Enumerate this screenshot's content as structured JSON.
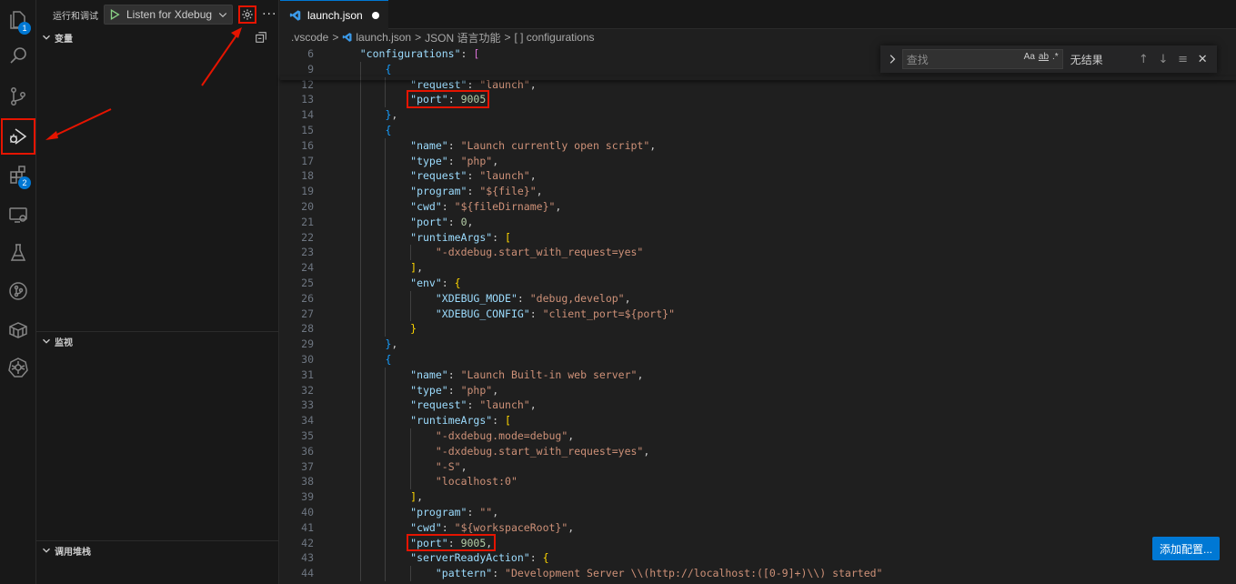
{
  "sidebar": {
    "title": "运行和调试",
    "run_config": "Listen for Xdebug",
    "more": "···",
    "sections": {
      "variables": "变量",
      "watch": "监视",
      "callstack": "调用堆栈"
    }
  },
  "activity": {
    "explorer_badge": "1",
    "extensions_badge": "2"
  },
  "tab": {
    "label": "launch.json"
  },
  "breadcrumb": {
    "folder": ".vscode",
    "file": "launch.json",
    "lang": "JSON 语言功能",
    "symbol": "[ ] configurations"
  },
  "find": {
    "placeholder": "查找",
    "opt_case": "Aa",
    "opt_word": "ab",
    "opt_regex": ".*",
    "status": "无结果",
    "prev": "↑",
    "next": "↓",
    "selection": "≡",
    "close": "✕"
  },
  "add_config": "添加配置...",
  "lines": [
    {
      "n": "6",
      "indent": 1,
      "t": [
        [
          "k",
          "\"configurations\""
        ],
        [
          "p",
          ": "
        ],
        [
          "b2",
          "["
        ]
      ]
    },
    {
      "n": "9",
      "indent": 2,
      "t": [
        [
          "b3",
          "{"
        ]
      ]
    },
    {
      "n": "12",
      "indent": 3,
      "t": [
        [
          "k",
          "\"request\""
        ],
        [
          "p",
          ": "
        ],
        [
          "s",
          "\"launch\""
        ],
        [
          "p",
          ","
        ]
      ]
    },
    {
      "n": "13",
      "indent": 3,
      "t": [
        [
          "k",
          "\"port\""
        ],
        [
          "p",
          ": "
        ],
        [
          "n",
          "9005"
        ]
      ]
    },
    {
      "n": "14",
      "indent": 2,
      "t": [
        [
          "b3",
          "}"
        ],
        [
          "p",
          ","
        ]
      ]
    },
    {
      "n": "15",
      "indent": 2,
      "t": [
        [
          "b3",
          "{"
        ]
      ]
    },
    {
      "n": "16",
      "indent": 3,
      "t": [
        [
          "k",
          "\"name\""
        ],
        [
          "p",
          ": "
        ],
        [
          "s",
          "\"Launch currently open script\""
        ],
        [
          "p",
          ","
        ]
      ]
    },
    {
      "n": "17",
      "indent": 3,
      "t": [
        [
          "k",
          "\"type\""
        ],
        [
          "p",
          ": "
        ],
        [
          "s",
          "\"php\""
        ],
        [
          "p",
          ","
        ]
      ]
    },
    {
      "n": "18",
      "indent": 3,
      "t": [
        [
          "k",
          "\"request\""
        ],
        [
          "p",
          ": "
        ],
        [
          "s",
          "\"launch\""
        ],
        [
          "p",
          ","
        ]
      ]
    },
    {
      "n": "19",
      "indent": 3,
      "t": [
        [
          "k",
          "\"program\""
        ],
        [
          "p",
          ": "
        ],
        [
          "s",
          "\"${file}\""
        ],
        [
          "p",
          ","
        ]
      ]
    },
    {
      "n": "20",
      "indent": 3,
      "t": [
        [
          "k",
          "\"cwd\""
        ],
        [
          "p",
          ": "
        ],
        [
          "s",
          "\"${fileDirname}\""
        ],
        [
          "p",
          ","
        ]
      ]
    },
    {
      "n": "21",
      "indent": 3,
      "t": [
        [
          "k",
          "\"port\""
        ],
        [
          "p",
          ": "
        ],
        [
          "n",
          "0"
        ],
        [
          "p",
          ","
        ]
      ]
    },
    {
      "n": "22",
      "indent": 3,
      "t": [
        [
          "k",
          "\"runtimeArgs\""
        ],
        [
          "p",
          ": "
        ],
        [
          "b1",
          "["
        ]
      ]
    },
    {
      "n": "23",
      "indent": 4,
      "t": [
        [
          "s",
          "\"-dxdebug.start_with_request=yes\""
        ]
      ]
    },
    {
      "n": "24",
      "indent": 3,
      "t": [
        [
          "b1",
          "]"
        ],
        [
          "p",
          ","
        ]
      ]
    },
    {
      "n": "25",
      "indent": 3,
      "t": [
        [
          "k",
          "\"env\""
        ],
        [
          "p",
          ": "
        ],
        [
          "b1",
          "{"
        ]
      ]
    },
    {
      "n": "26",
      "indent": 4,
      "t": [
        [
          "k",
          "\"XDEBUG_MODE\""
        ],
        [
          "p",
          ": "
        ],
        [
          "s",
          "\"debug,develop\""
        ],
        [
          "p",
          ","
        ]
      ]
    },
    {
      "n": "27",
      "indent": 4,
      "t": [
        [
          "k",
          "\"XDEBUG_CONFIG\""
        ],
        [
          "p",
          ": "
        ],
        [
          "s",
          "\"client_port=${port}\""
        ]
      ]
    },
    {
      "n": "28",
      "indent": 3,
      "t": [
        [
          "b1",
          "}"
        ]
      ]
    },
    {
      "n": "29",
      "indent": 2,
      "t": [
        [
          "b3",
          "}"
        ],
        [
          "p",
          ","
        ]
      ]
    },
    {
      "n": "30",
      "indent": 2,
      "t": [
        [
          "b3",
          "{"
        ]
      ]
    },
    {
      "n": "31",
      "indent": 3,
      "t": [
        [
          "k",
          "\"name\""
        ],
        [
          "p",
          ": "
        ],
        [
          "s",
          "\"Launch Built-in web server\""
        ],
        [
          "p",
          ","
        ]
      ]
    },
    {
      "n": "32",
      "indent": 3,
      "t": [
        [
          "k",
          "\"type\""
        ],
        [
          "p",
          ": "
        ],
        [
          "s",
          "\"php\""
        ],
        [
          "p",
          ","
        ]
      ]
    },
    {
      "n": "33",
      "indent": 3,
      "t": [
        [
          "k",
          "\"request\""
        ],
        [
          "p",
          ": "
        ],
        [
          "s",
          "\"launch\""
        ],
        [
          "p",
          ","
        ]
      ]
    },
    {
      "n": "34",
      "indent": 3,
      "t": [
        [
          "k",
          "\"runtimeArgs\""
        ],
        [
          "p",
          ": "
        ],
        [
          "b1",
          "["
        ]
      ]
    },
    {
      "n": "35",
      "indent": 4,
      "t": [
        [
          "s",
          "\"-dxdebug.mode=debug\""
        ],
        [
          "p",
          ","
        ]
      ]
    },
    {
      "n": "36",
      "indent": 4,
      "t": [
        [
          "s",
          "\"-dxdebug.start_with_request=yes\""
        ],
        [
          "p",
          ","
        ]
      ]
    },
    {
      "n": "37",
      "indent": 4,
      "t": [
        [
          "s",
          "\"-S\""
        ],
        [
          "p",
          ","
        ]
      ]
    },
    {
      "n": "38",
      "indent": 4,
      "t": [
        [
          "s",
          "\"localhost:0\""
        ]
      ]
    },
    {
      "n": "39",
      "indent": 3,
      "t": [
        [
          "b1",
          "]"
        ],
        [
          "p",
          ","
        ]
      ]
    },
    {
      "n": "40",
      "indent": 3,
      "t": [
        [
          "k",
          "\"program\""
        ],
        [
          "p",
          ": "
        ],
        [
          "s",
          "\"\""
        ],
        [
          "p",
          ","
        ]
      ]
    },
    {
      "n": "41",
      "indent": 3,
      "t": [
        [
          "k",
          "\"cwd\""
        ],
        [
          "p",
          ": "
        ],
        [
          "s",
          "\"${workspaceRoot}\""
        ],
        [
          "p",
          ","
        ]
      ]
    },
    {
      "n": "42",
      "indent": 3,
      "t": [
        [
          "k",
          "\"port\""
        ],
        [
          "p",
          ": "
        ],
        [
          "n",
          "9005"
        ],
        [
          "p",
          ","
        ]
      ]
    },
    {
      "n": "43",
      "indent": 3,
      "t": [
        [
          "k",
          "\"serverReadyAction\""
        ],
        [
          "p",
          ": "
        ],
        [
          "b1",
          "{"
        ]
      ]
    },
    {
      "n": "44",
      "indent": 4,
      "t": [
        [
          "k",
          "\"pattern\""
        ],
        [
          "p",
          ": "
        ],
        [
          "s",
          "\"Development Server \\\\(http://localhost:([0-9]+)\\\\) started\""
        ]
      ]
    }
  ],
  "colors": {
    "accent": "#0078d4",
    "highlight": "#e51400"
  }
}
